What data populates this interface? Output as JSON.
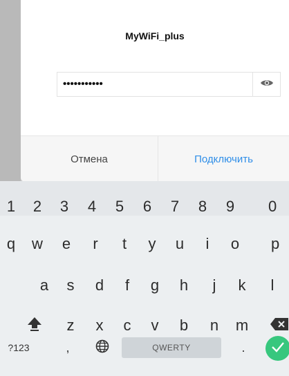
{
  "dialog": {
    "title": "MyWiFi_plus",
    "password_value": "•••••••••••",
    "cancel_label": "Отмена",
    "connect_label": "Подключить"
  },
  "keyboard": {
    "numbers": [
      "1",
      "2",
      "3",
      "4",
      "5",
      "6",
      "7",
      "8",
      "9",
      "0"
    ],
    "row1": [
      "q",
      "w",
      "e",
      "r",
      "t",
      "y",
      "u",
      "i",
      "o",
      "p"
    ],
    "row2": [
      "a",
      "s",
      "d",
      "f",
      "g",
      "h",
      "j",
      "k",
      "l"
    ],
    "row3": [
      "z",
      "x",
      "c",
      "v",
      "b",
      "n",
      "m"
    ],
    "symbols_label": "?123",
    "comma": ",",
    "space_label": "QWERTY",
    "period": "."
  },
  "colors": {
    "accent": "#2f8ee8",
    "enter": "#37c77e"
  },
  "icons": {
    "visibility": "eye-icon",
    "shift": "shift-icon",
    "backspace": "backspace-icon",
    "language": "globe-icon",
    "enter": "check-icon"
  }
}
